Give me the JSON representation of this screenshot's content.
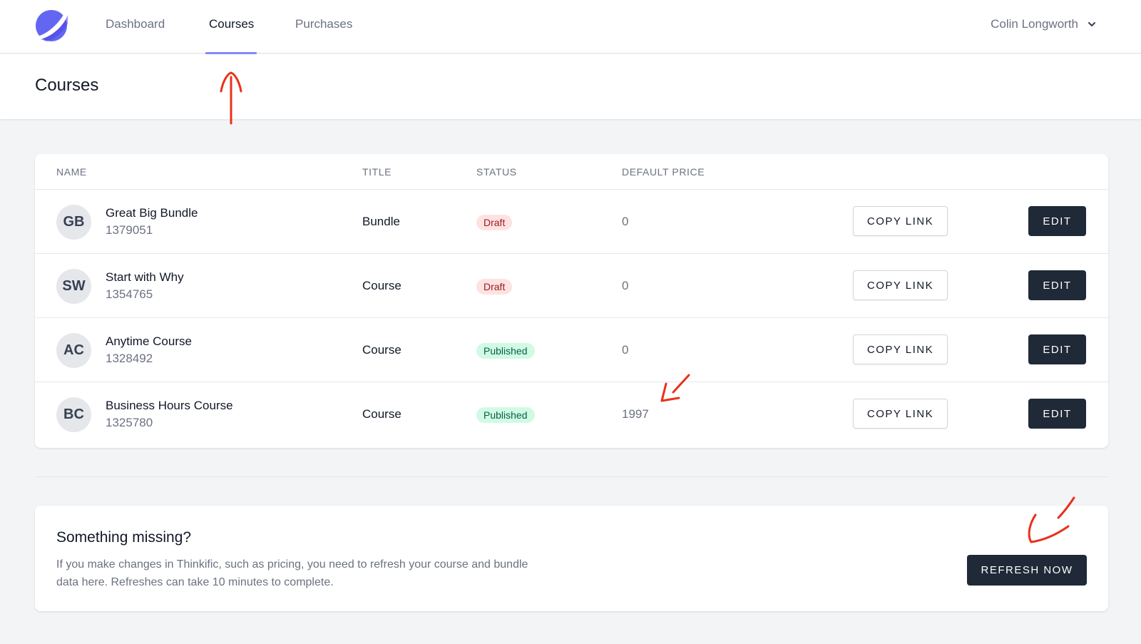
{
  "nav": {
    "items": [
      {
        "label": "Dashboard",
        "active": false
      },
      {
        "label": "Courses",
        "active": true
      },
      {
        "label": "Purchases",
        "active": false
      }
    ],
    "user_name": "Colin Longworth",
    "accent_color": "#818cf8"
  },
  "header": {
    "title": "Courses"
  },
  "table": {
    "columns": [
      "NAME",
      "TITLE",
      "STATUS",
      "DEFAULT PRICE"
    ],
    "rows": [
      {
        "initials": "GB",
        "name": "Great Big Bundle",
        "id": "1379051",
        "title": "Bundle",
        "status": "Draft",
        "price": "0",
        "copy_label": "COPY LINK",
        "edit_label": "EDIT"
      },
      {
        "initials": "SW",
        "name": "Start with Why",
        "id": "1354765",
        "title": "Course",
        "status": "Draft",
        "price": "0",
        "copy_label": "COPY LINK",
        "edit_label": "EDIT"
      },
      {
        "initials": "AC",
        "name": "Anytime Course",
        "id": "1328492",
        "title": "Course",
        "status": "Published",
        "price": "0",
        "copy_label": "COPY LINK",
        "edit_label": "EDIT"
      },
      {
        "initials": "BC",
        "name": "Business Hours Course",
        "id": "1325780",
        "title": "Course",
        "status": "Published",
        "price": "1997",
        "copy_label": "COPY LINK",
        "edit_label": "EDIT"
      }
    ]
  },
  "refresh": {
    "title": "Something missing?",
    "description": "If you make changes in Thinkific, such as pricing, you need to refresh your course and bundle data here. Refreshes can take 10 minutes to complete.",
    "button_label": "REFRESH NOW"
  },
  "colors": {
    "primary_dark": "#1f2937",
    "draft_bg": "#fee2e2",
    "published_bg": "#d1fae5",
    "annotation_red": "#e8321a"
  }
}
